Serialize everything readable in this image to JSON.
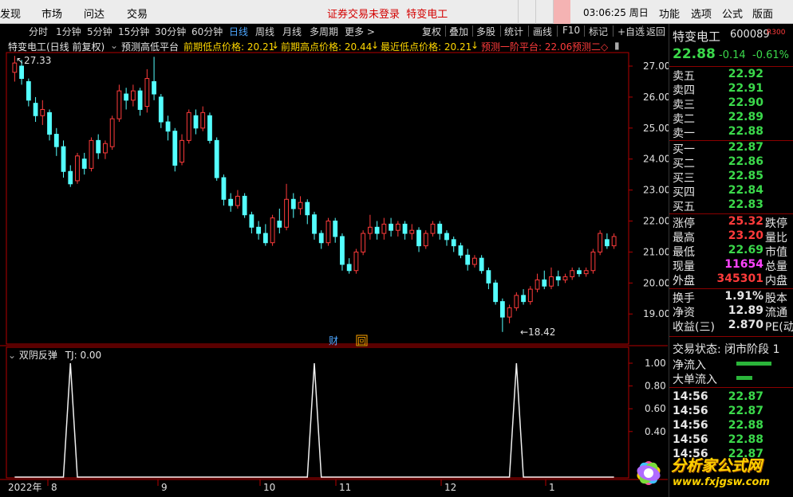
{
  "menubar": {
    "items": [
      "发现",
      "市场",
      "问达",
      "交易"
    ],
    "center_notice": "证券交易未登录",
    "center_stock": "特变电工",
    "clock": "03:06:25 周日",
    "right_items": [
      "功能",
      "选项",
      "公式",
      "版面"
    ]
  },
  "tabs": {
    "periods": [
      "分时",
      "1分钟",
      "5分钟",
      "15分钟",
      "30分钟",
      "60分钟",
      "日线",
      "周线",
      "月线",
      "多周期",
      "更多 >"
    ],
    "selected": "日线",
    "right_buttons": [
      "复权",
      "叠加",
      "多股",
      "统计",
      "画线",
      "F10",
      "标记",
      "+自选",
      "返回"
    ]
  },
  "indicator_line": {
    "stock": "特变电工(日线 前复权)",
    "indicator": "预测高低平台",
    "prev_low_label": "前期低点价格: 20.21",
    "prev_high_label": "前期高点价格: 20.44",
    "recent_low_label": "最近低点价格: 20.21",
    "predict1_label": "预测一阶平台: 22.06",
    "predict2_label": "预测二◇"
  },
  "main_chart": {
    "high_label": "27.33",
    "low_label": "18.42",
    "badge_cai": "财",
    "badge_hui": "回",
    "y_ticks": [
      "27.00",
      "26.00",
      "25.00",
      "24.00",
      "23.00",
      "22.00",
      "21.00",
      "20.00",
      "19.00"
    ]
  },
  "sub_chart": {
    "title": "双阴反弹",
    "tj_label": "TJ: 0.00",
    "y_ticks": [
      "1.00",
      "0.80",
      "0.60",
      "0.40"
    ]
  },
  "x_axis": {
    "labels": [
      "2022年",
      "8",
      "9",
      "10",
      "11",
      "12",
      "1"
    ]
  },
  "chart_data": {
    "type": "candlestick",
    "title": "特变电工(日线 前复权)",
    "ylim": [
      18.0,
      27.6
    ],
    "high_marker": 27.33,
    "low_marker": 18.42,
    "candles": [
      [
        26.8,
        27.1,
        26.5,
        27.33
      ],
      [
        27.0,
        26.6,
        26.4,
        27.2
      ],
      [
        26.5,
        25.9,
        25.7,
        26.6
      ],
      [
        25.8,
        25.4,
        25.2,
        26.0
      ],
      [
        25.4,
        25.6,
        25.1,
        25.9
      ],
      [
        25.5,
        24.8,
        24.6,
        25.6
      ],
      [
        24.8,
        24.4,
        24.1,
        25.0
      ],
      [
        24.4,
        23.6,
        23.4,
        24.6
      ],
      [
        23.6,
        23.2,
        23.1,
        23.8
      ],
      [
        23.3,
        24.1,
        23.2,
        24.2
      ],
      [
        24.0,
        23.7,
        23.5,
        24.2
      ],
      [
        23.7,
        24.6,
        23.6,
        24.7
      ],
      [
        24.6,
        24.2,
        24.0,
        24.8
      ],
      [
        24.2,
        24.5,
        24.0,
        24.6
      ],
      [
        24.4,
        25.3,
        24.3,
        25.4
      ],
      [
        25.3,
        26.2,
        25.2,
        26.4
      ],
      [
        26.1,
        25.9,
        25.6,
        26.3
      ],
      [
        25.9,
        26.2,
        25.7,
        26.4
      ],
      [
        26.2,
        25.6,
        25.4,
        26.3
      ],
      [
        25.7,
        26.6,
        25.5,
        26.9
      ],
      [
        26.5,
        26.1,
        25.9,
        27.3
      ],
      [
        26.0,
        25.2,
        25.0,
        26.1
      ],
      [
        25.2,
        24.9,
        24.6,
        25.4
      ],
      [
        24.9,
        23.8,
        23.6,
        25.0
      ],
      [
        23.9,
        24.6,
        23.8,
        24.8
      ],
      [
        24.6,
        25.5,
        24.5,
        25.6
      ],
      [
        25.4,
        25.0,
        24.8,
        25.6
      ],
      [
        25.0,
        25.5,
        24.9,
        25.7
      ],
      [
        25.4,
        24.6,
        24.5,
        25.5
      ],
      [
        24.6,
        23.4,
        23.3,
        24.7
      ],
      [
        23.4,
        22.7,
        22.5,
        23.5
      ],
      [
        22.7,
        22.5,
        22.3,
        22.9
      ],
      [
        22.5,
        22.8,
        22.4,
        23.0
      ],
      [
        22.8,
        22.2,
        22.1,
        22.9
      ],
      [
        22.2,
        21.8,
        21.6,
        22.3
      ],
      [
        21.8,
        21.6,
        21.4,
        22.0
      ],
      [
        21.6,
        21.3,
        21.2,
        21.9
      ],
      [
        21.3,
        22.1,
        21.2,
        22.2
      ],
      [
        22.0,
        21.8,
        21.6,
        22.4
      ],
      [
        21.8,
        22.7,
        21.7,
        23.2
      ],
      [
        22.7,
        22.4,
        22.1,
        22.9
      ],
      [
        22.4,
        22.6,
        22.2,
        22.8
      ],
      [
        22.6,
        22.2,
        21.9,
        22.7
      ],
      [
        22.2,
        21.6,
        21.4,
        22.3
      ],
      [
        21.6,
        21.3,
        21.1,
        21.7
      ],
      [
        21.3,
        22.0,
        21.2,
        22.1
      ],
      [
        22.0,
        21.5,
        21.3,
        22.1
      ],
      [
        21.5,
        20.6,
        20.4,
        21.6
      ],
      [
        20.6,
        20.4,
        20.3,
        20.8
      ],
      [
        20.4,
        21.0,
        20.3,
        21.1
      ],
      [
        21.0,
        21.6,
        20.9,
        21.7
      ],
      [
        21.6,
        21.8,
        21.4,
        22.2
      ],
      [
        21.8,
        21.6,
        21.4,
        22.0
      ],
      [
        21.6,
        21.9,
        21.4,
        22.1
      ],
      [
        21.9,
        21.7,
        21.5,
        22.1
      ],
      [
        21.7,
        21.9,
        21.5,
        22.0
      ],
      [
        21.9,
        21.6,
        21.4,
        22.0
      ],
      [
        21.6,
        21.7,
        21.4,
        21.9
      ],
      [
        21.7,
        21.2,
        21.0,
        21.8
      ],
      [
        21.2,
        21.6,
        21.1,
        21.7
      ],
      [
        21.6,
        21.9,
        21.5,
        22.0
      ],
      [
        21.9,
        21.6,
        21.4,
        22.0
      ],
      [
        21.6,
        21.4,
        21.2,
        21.7
      ],
      [
        21.4,
        21.2,
        21.0,
        21.5
      ],
      [
        21.2,
        20.9,
        20.8,
        21.3
      ],
      [
        20.9,
        20.6,
        20.4,
        21.1
      ],
      [
        20.6,
        20.8,
        20.5,
        20.9
      ],
      [
        20.8,
        20.4,
        20.3,
        20.9
      ],
      [
        20.4,
        20.0,
        19.8,
        20.5
      ],
      [
        20.0,
        19.4,
        19.3,
        20.1
      ],
      [
        19.4,
        18.9,
        18.42,
        19.5
      ],
      [
        18.9,
        19.2,
        18.7,
        19.3
      ],
      [
        19.2,
        19.6,
        19.1,
        19.7
      ],
      [
        19.6,
        19.4,
        19.3,
        19.8
      ],
      [
        19.4,
        19.8,
        19.3,
        19.9
      ],
      [
        19.8,
        20.1,
        19.7,
        20.3
      ],
      [
        20.1,
        19.9,
        19.8,
        20.4
      ],
      [
        19.9,
        20.2,
        19.8,
        20.5
      ],
      [
        20.2,
        20.1,
        19.9,
        20.4
      ],
      [
        20.1,
        20.2,
        20.0,
        20.3
      ],
      [
        20.2,
        20.4,
        20.1,
        20.5
      ],
      [
        20.4,
        20.3,
        20.2,
        20.5
      ],
      [
        20.3,
        20.4,
        20.2,
        20.5
      ],
      [
        20.4,
        21.0,
        20.3,
        21.1
      ],
      [
        21.0,
        21.6,
        20.9,
        21.7
      ],
      [
        21.4,
        21.2,
        21.1,
        21.6
      ],
      [
        21.2,
        21.5,
        21.1,
        21.6
      ]
    ]
  },
  "signal_series": {
    "name": "TJ",
    "pulses_at_candle": [
      8,
      43,
      72
    ]
  },
  "right_panel": {
    "stock_name": "特变电工",
    "stock_code": "600089",
    "r_badge": "R300",
    "price": "22.88",
    "change": "-0.14",
    "change_pct": "-0.61%",
    "asks": [
      {
        "label": "卖五",
        "price": "22.92"
      },
      {
        "label": "卖四",
        "price": "22.91"
      },
      {
        "label": "卖三",
        "price": "22.90"
      },
      {
        "label": "卖二",
        "price": "22.89"
      },
      {
        "label": "卖一",
        "price": "22.88"
      }
    ],
    "bids": [
      {
        "label": "买一",
        "price": "22.87"
      },
      {
        "label": "买二",
        "price": "22.86"
      },
      {
        "label": "买三",
        "price": "22.85"
      },
      {
        "label": "买四",
        "price": "22.84"
      },
      {
        "label": "买五",
        "price": "22.83"
      }
    ],
    "stats": [
      {
        "label": "涨停",
        "value": "25.32",
        "color": "red",
        "label2": "跌停"
      },
      {
        "label": "最高",
        "value": "23.20",
        "color": "red",
        "label2": "量比"
      },
      {
        "label": "最低",
        "value": "22.69",
        "color": "green",
        "label2": "市值"
      },
      {
        "label": "现量",
        "value": "11654",
        "color": "magenta",
        "label2": "总量"
      },
      {
        "label": "外盘",
        "value": "345301",
        "color": "red",
        "label2": "内盘"
      }
    ],
    "stats2": [
      {
        "label": "换手",
        "value": "1.91%",
        "label2": "股本"
      },
      {
        "label": "净资",
        "value": "12.89",
        "label2": "流通"
      },
      {
        "label": "收益(三)",
        "value": "2.870",
        "label2": "PE(动"
      }
    ],
    "trade_status": "交易状态: 闭市阶段 1",
    "net_inflow": "净流入",
    "big_inflow": "大单流入",
    "ticks": [
      {
        "time": "14:56",
        "price": "22.87"
      },
      {
        "time": "14:56",
        "price": "22.87"
      },
      {
        "time": "14:56",
        "price": "22.88"
      },
      {
        "time": "14:56",
        "price": "22.88"
      },
      {
        "time": "14:56",
        "price": "22.87"
      }
    ]
  },
  "watermark": {
    "text1": "分析家公式网",
    "text2": "www.fxjgsw.com"
  },
  "colors": {
    "up": "#ff3b3b",
    "down": "#54ffff",
    "grid": "#8b0000",
    "axis": "#b40000"
  }
}
